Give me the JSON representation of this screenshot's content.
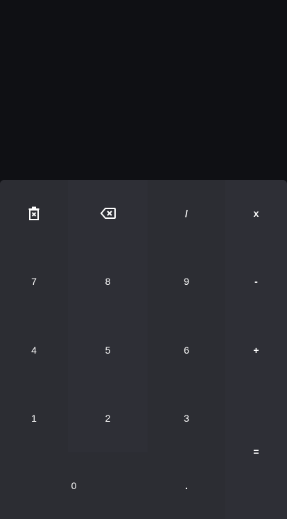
{
  "display": {
    "expression": "",
    "result": ""
  },
  "keys": {
    "clear_icon": "trash-x-icon",
    "backspace_icon": "backspace-x-icon",
    "divide": "/",
    "multiply": "x",
    "seven": "7",
    "eight": "8",
    "nine": "9",
    "minus": "-",
    "four": "4",
    "five": "5",
    "six": "6",
    "plus": "+",
    "one": "1",
    "two": "2",
    "three": "3",
    "equals": "=",
    "zero": "0",
    "decimal": "."
  },
  "colors": {
    "background": "#0f1014",
    "keypad": "#2c2d33",
    "key_text": "#ffffff"
  }
}
